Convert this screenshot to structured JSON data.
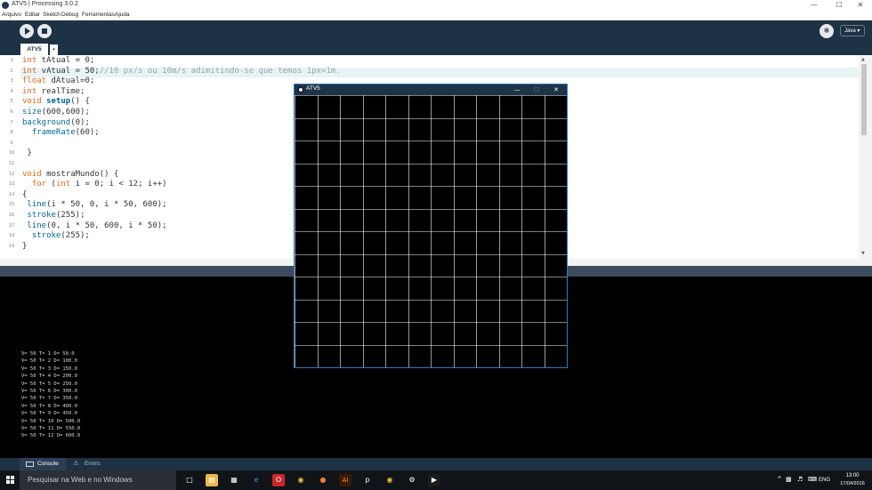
{
  "window": {
    "title": "ATV5 | Processing 3.0.2",
    "controls": {
      "minimize": "—",
      "maximize": "☐",
      "close": "✕"
    }
  },
  "menu": [
    "Arquivo",
    "Editar",
    "Sketch",
    "Debug",
    "Ferramentas",
    "Ajuda"
  ],
  "toolbar": {
    "mode": "Java ▾",
    "mode_icon": "butterfly-icon"
  },
  "tab": {
    "name": "ATV5",
    "menu_arrow": "▾"
  },
  "code": {
    "line_numbers": [
      "1",
      "2",
      "3",
      "4",
      "5",
      "6",
      "7",
      "8",
      "9",
      "10",
      "11",
      "12",
      "13",
      "14",
      "15",
      "16",
      "17",
      "18",
      "19"
    ],
    "current_line": 2,
    "lines": [
      [
        {
          "t": "int",
          "c": "kw"
        },
        {
          "t": " tAtual = 0;",
          "c": ""
        }
      ],
      [
        {
          "t": "int",
          "c": "kw"
        },
        {
          "t": " vAtual = 50;",
          "c": ""
        },
        {
          "t": "//10 px/s ou 10m/s adimitindo-se que temos 1px=1m.",
          "c": "cm"
        }
      ],
      [
        {
          "t": "float",
          "c": "kw"
        },
        {
          "t": " dAtual=0;",
          "c": ""
        }
      ],
      [
        {
          "t": "int",
          "c": "kw"
        },
        {
          "t": " realTime;",
          "c": ""
        }
      ],
      [
        {
          "t": "void",
          "c": "kw"
        },
        {
          "t": " ",
          "c": ""
        },
        {
          "t": "setup",
          "c": "fnb"
        },
        {
          "t": "() {",
          "c": ""
        }
      ],
      [
        {
          "t": "size",
          "c": "fn"
        },
        {
          "t": "(600,600);",
          "c": ""
        }
      ],
      [
        {
          "t": "background",
          "c": "fn"
        },
        {
          "t": "(0);",
          "c": ""
        }
      ],
      [
        {
          "t": "  ",
          "c": ""
        },
        {
          "t": "frameRate",
          "c": "fn"
        },
        {
          "t": "(60);",
          "c": ""
        }
      ],
      [
        {
          "t": "",
          "c": ""
        }
      ],
      [
        {
          "t": " }",
          "c": ""
        }
      ],
      [
        {
          "t": "",
          "c": ""
        }
      ],
      [
        {
          "t": "void",
          "c": "kw"
        },
        {
          "t": " mostraMundo() {",
          "c": ""
        }
      ],
      [
        {
          "t": "  ",
          "c": ""
        },
        {
          "t": "for",
          "c": "kw"
        },
        {
          "t": " (",
          "c": ""
        },
        {
          "t": "int",
          "c": "kw"
        },
        {
          "t": " i = 0; i < 12; i++)",
          "c": ""
        }
      ],
      [
        {
          "t": "{",
          "c": ""
        }
      ],
      [
        {
          "t": " ",
          "c": ""
        },
        {
          "t": "line",
          "c": "fn"
        },
        {
          "t": "(i * 50, 0, i * 50, 600);",
          "c": ""
        }
      ],
      [
        {
          "t": " ",
          "c": ""
        },
        {
          "t": "stroke",
          "c": "fn"
        },
        {
          "t": "(255);",
          "c": ""
        }
      ],
      [
        {
          "t": " ",
          "c": ""
        },
        {
          "t": "line",
          "c": "fn"
        },
        {
          "t": "(0, i * 50, 600, i * 50);",
          "c": ""
        }
      ],
      [
        {
          "t": "  ",
          "c": ""
        },
        {
          "t": "stroke",
          "c": "fn"
        },
        {
          "t": "(255);",
          "c": ""
        }
      ],
      [
        {
          "t": "}",
          "c": ""
        }
      ]
    ]
  },
  "console": {
    "lines": [
      "V= 50 T= 1 D= 50.0",
      "V= 50 T= 2 D= 100.0",
      "V= 50 T= 3 D= 150.0",
      "V= 50 T= 4 D= 200.0",
      "V= 50 T= 5 D= 250.0",
      "V= 50 T= 6 D= 300.0",
      "V= 50 T= 7 D= 350.0",
      "V= 50 T= 8 D= 400.0",
      "V= 50 T= 9 D= 450.0",
      "V= 50 T= 10 D= 500.0",
      "V= 50 T= 11 D= 550.0",
      "V= 50 T= 12 D= 600.0"
    ],
    "tabs": {
      "console": "Console",
      "errors": "Errors"
    }
  },
  "sketch": {
    "title": "ATV5",
    "grid_divisions": 12,
    "background": "#000000",
    "grid_color": "#ffffff",
    "controls": {
      "minimize": "—",
      "maximize": "☐",
      "close": "✕"
    }
  },
  "taskbar": {
    "search_placeholder": "Pesquisar na Web e no Windows",
    "apps": [
      "task-view-icon",
      "file-explorer-icon",
      "store-icon",
      "edge-icon",
      "opera-icon",
      "chrome-icon",
      "firefox-icon",
      "illustrator-icon",
      "processing-icon",
      "chrome-icon",
      "settings-icon",
      "processing-sketch-icon"
    ],
    "language": "ENG",
    "time": "13:00",
    "date": "17/04/2016"
  },
  "colors": {
    "toolbar": "#1e3246",
    "keyword": "#e2661a",
    "function": "#006699",
    "comment": "#95a5a6"
  }
}
